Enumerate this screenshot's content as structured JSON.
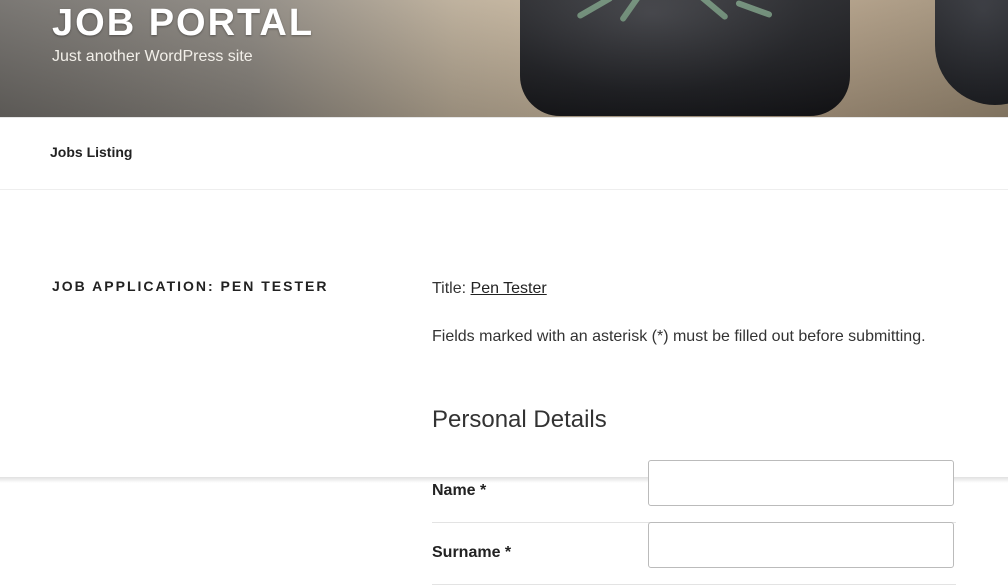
{
  "site": {
    "title": "JOB PORTAL",
    "description": "Just another WordPress site"
  },
  "nav": {
    "items": [
      {
        "label": "Jobs Listing"
      }
    ]
  },
  "page": {
    "title": "JOB APPLICATION: PEN TESTER",
    "job_title_prefix": "Title:",
    "job_title_link": "Pen Tester",
    "required_notice": "Fields marked with an asterisk (*) must be filled out before submitting.",
    "section_heading": "Personal Details"
  },
  "form": {
    "fields": [
      {
        "label": "Name *",
        "value": ""
      },
      {
        "label": "Surname *",
        "value": ""
      }
    ]
  },
  "colors": {
    "text": "#222222",
    "border": "#bbbbbb",
    "divider": "#e3e3e3"
  }
}
